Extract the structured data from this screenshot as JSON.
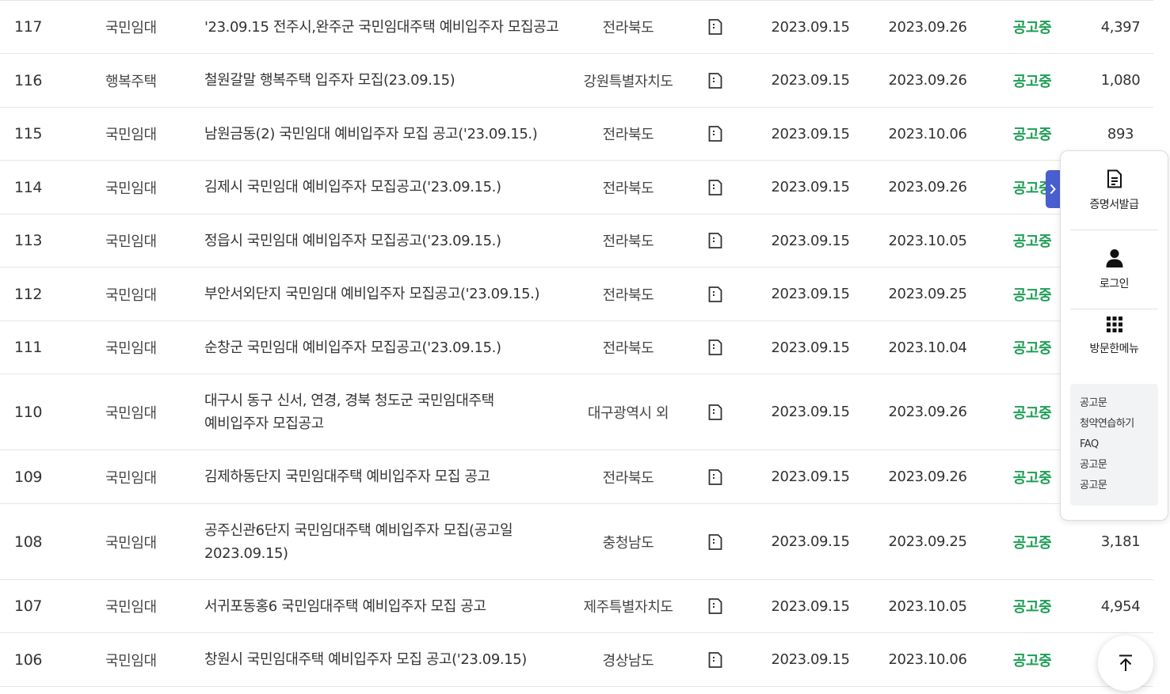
{
  "table": {
    "rows": [
      {
        "no": "117",
        "type": "국민임대",
        "title": "'23.09.15 전주시,완주군 국민임대주택 예비입주자 모집공고",
        "region": "전라북도",
        "post_date": "2023.09.15",
        "deadline": "2023.09.26",
        "status": "공고중",
        "views": "4,397"
      },
      {
        "no": "116",
        "type": "행복주택",
        "title": "철원갈말 행복주택 입주자 모집(23.09.15)",
        "region": "강원특별자치도",
        "post_date": "2023.09.15",
        "deadline": "2023.09.26",
        "status": "공고중",
        "views": "1,080"
      },
      {
        "no": "115",
        "type": "국민임대",
        "title": "남원금동(2) 국민임대 예비입주자 모집 공고('23.09.15.)",
        "region": "전라북도",
        "post_date": "2023.09.15",
        "deadline": "2023.10.06",
        "status": "공고중",
        "views": "893"
      },
      {
        "no": "114",
        "type": "국민임대",
        "title": "김제시 국민임대 예비입주자 모집공고('23.09.15.)",
        "region": "전라북도",
        "post_date": "2023.09.15",
        "deadline": "2023.09.26",
        "status": "공고중",
        "views": ""
      },
      {
        "no": "113",
        "type": "국민임대",
        "title": "정읍시 국민임대 예비입주자 모집공고('23.09.15.)",
        "region": "전라북도",
        "post_date": "2023.09.15",
        "deadline": "2023.10.05",
        "status": "공고중",
        "views": ""
      },
      {
        "no": "112",
        "type": "국민임대",
        "title": "부안서외단지 국민임대 예비입주자 모집공고('23.09.15.)",
        "region": "전라북도",
        "post_date": "2023.09.15",
        "deadline": "2023.09.25",
        "status": "공고중",
        "views": ""
      },
      {
        "no": "111",
        "type": "국민임대",
        "title": "순창군 국민임대 예비입주자 모집공고('23.09.15.)",
        "region": "전라북도",
        "post_date": "2023.09.15",
        "deadline": "2023.10.04",
        "status": "공고중",
        "views": ""
      },
      {
        "no": "110",
        "type": "국민임대",
        "title": "대구시 동구 신서, 연경, 경북 청도군 국민임대주택 예비입주자 모집공고",
        "region": "대구광역시 외",
        "post_date": "2023.09.15",
        "deadline": "2023.09.26",
        "status": "공고중",
        "views": ""
      },
      {
        "no": "109",
        "type": "국민임대",
        "title": "김제하동단지 국민임대주택 예비입주자 모집 공고",
        "region": "전라북도",
        "post_date": "2023.09.15",
        "deadline": "2023.09.26",
        "status": "공고중",
        "views": ""
      },
      {
        "no": "108",
        "type": "국민임대",
        "title": "공주신관6단지 국민임대주택 예비입주자 모집(공고일 2023.09.15)",
        "region": "충청남도",
        "post_date": "2023.09.15",
        "deadline": "2023.09.25",
        "status": "공고중",
        "views": "3,181"
      },
      {
        "no": "107",
        "type": "국민임대",
        "title": "서귀포동홍6 국민임대주택 예비입주자 모집 공고",
        "region": "제주특별자치도",
        "post_date": "2023.09.15",
        "deadline": "2023.10.05",
        "status": "공고중",
        "views": "4,954"
      },
      {
        "no": "106",
        "type": "국민임대",
        "title": "창원시 국민임대주택 예비입주자 모집 공고('23.09.15)",
        "region": "경상남도",
        "post_date": "2023.09.15",
        "deadline": "2023.10.06",
        "status": "공고중",
        "views": "6"
      }
    ]
  },
  "quick_menu": {
    "items": [
      {
        "label": "증명서발급",
        "icon": "document-icon"
      },
      {
        "label": "로그인",
        "icon": "person-icon"
      },
      {
        "label": "방문한메뉴",
        "icon": "grid-icon"
      }
    ],
    "visited": [
      "공고문",
      "청약연습하기",
      "FAQ",
      "공고문",
      "공고문"
    ]
  },
  "colors": {
    "status_green": "#1e9e56",
    "accent_blue": "#4a5fcf"
  }
}
